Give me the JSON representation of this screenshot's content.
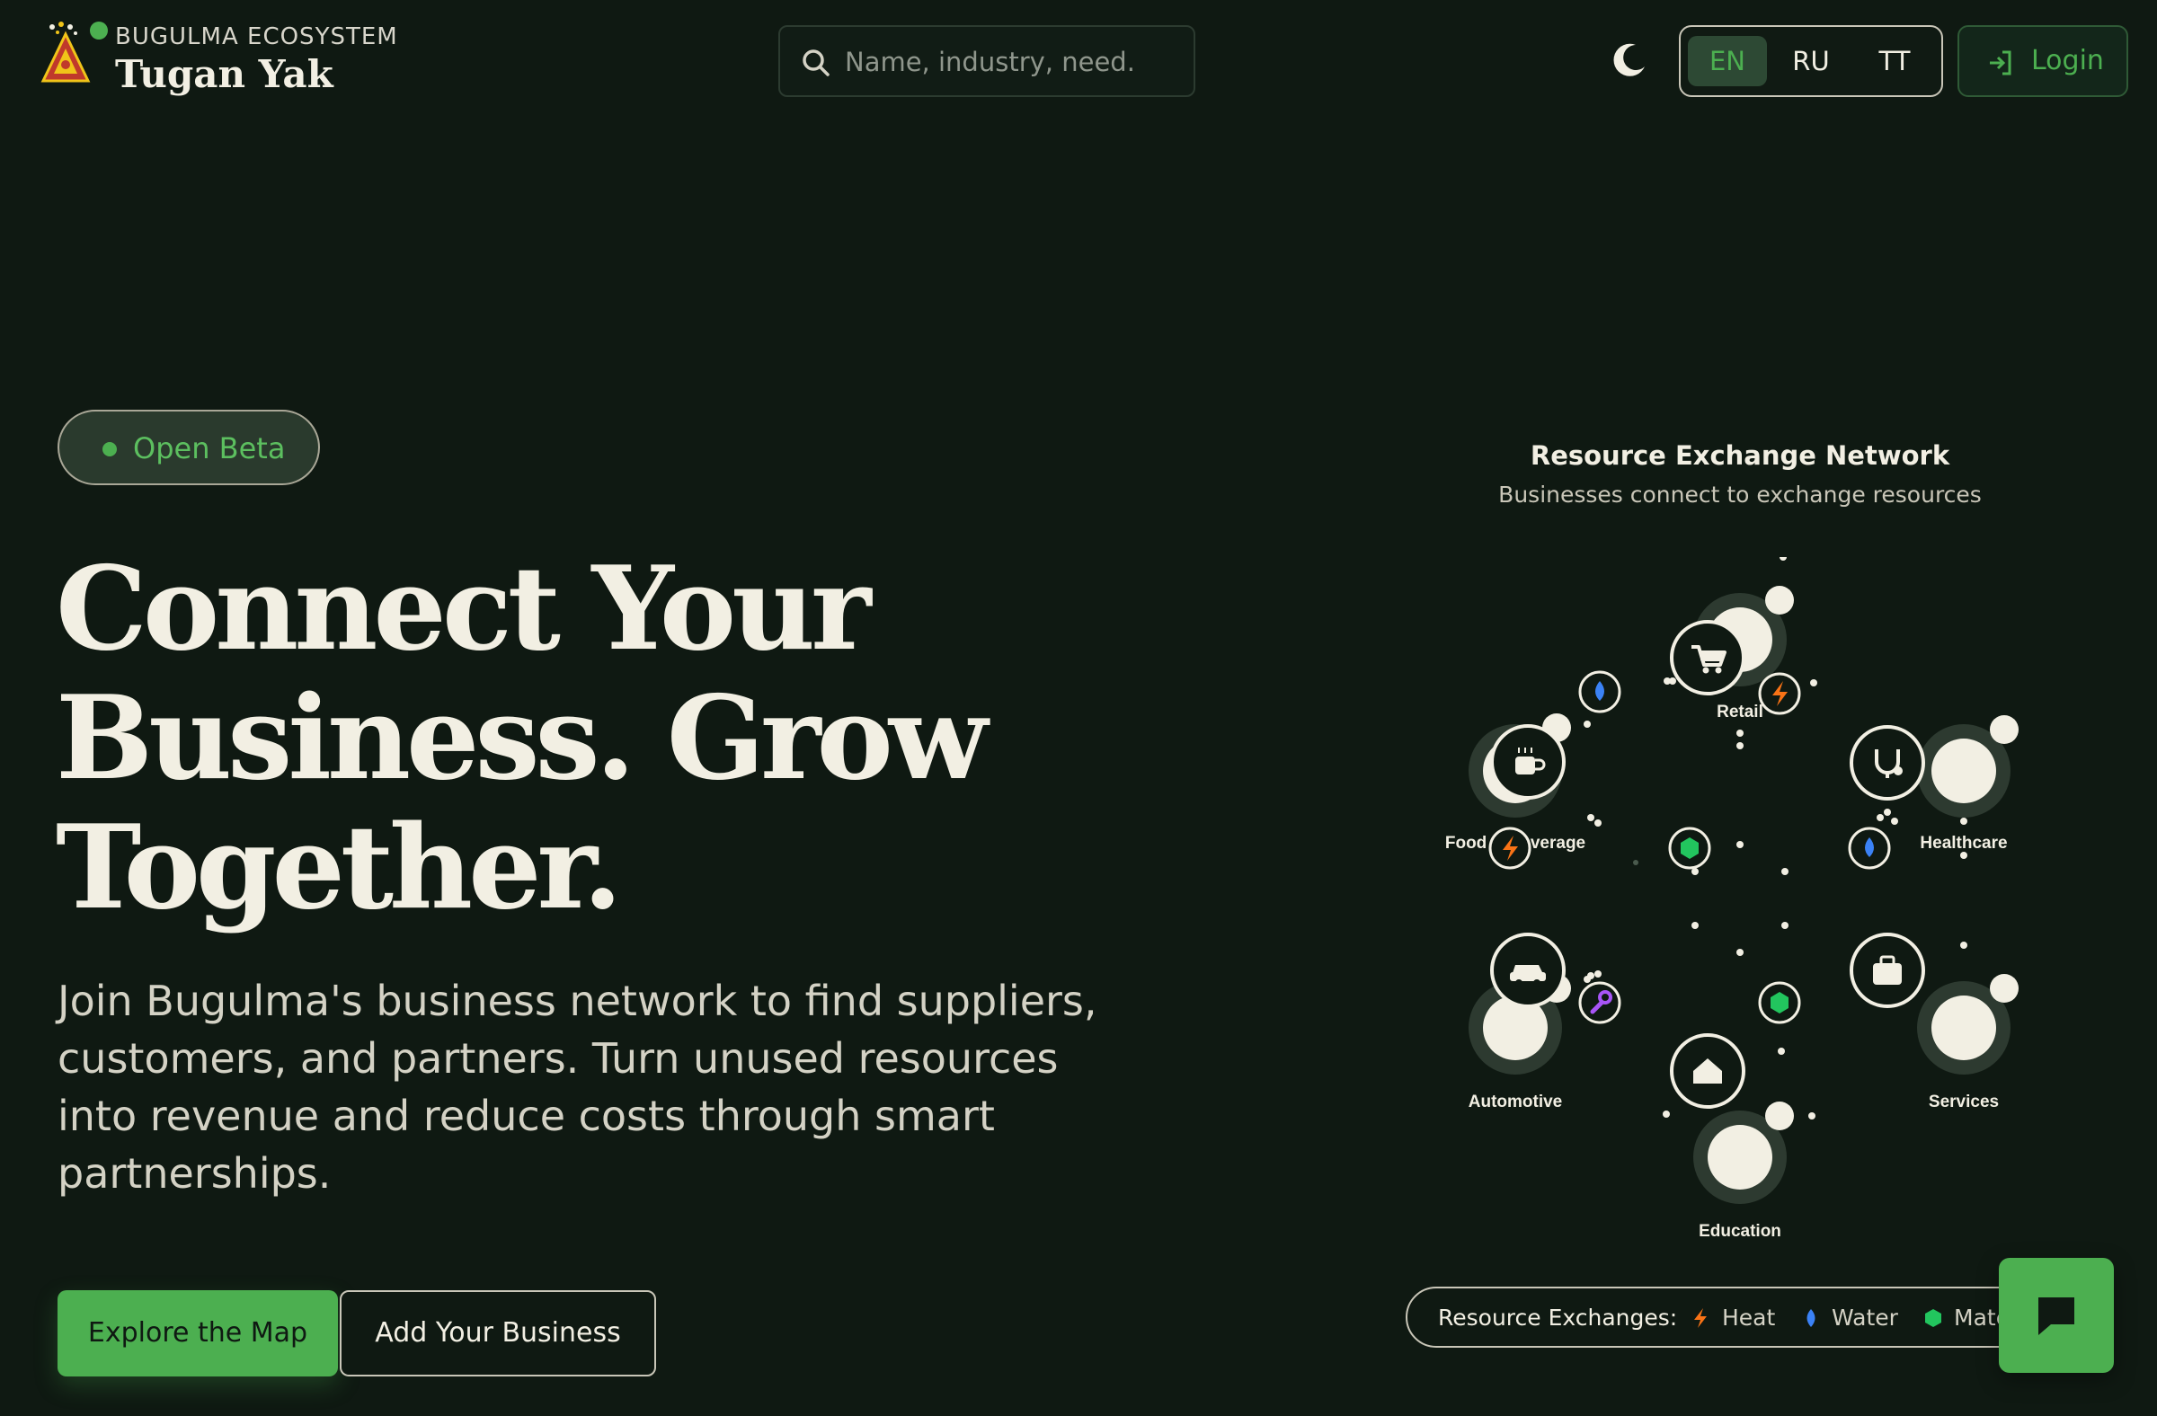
{
  "header": {
    "eyebrow": "BUGULMA ECOSYSTEM",
    "brand_name": "Tugan Yak",
    "logo_icon": "pyramid-emblem-logo",
    "search_placeholder": "Name, industry, need.",
    "theme_icon": "moon-icon",
    "languages": [
      {
        "code": "EN",
        "active": true
      },
      {
        "code": "RU",
        "active": false
      },
      {
        "code": "TT",
        "active": false
      }
    ],
    "login_label": "Login"
  },
  "hero": {
    "badge": "Open Beta",
    "headline_line1": "Connect Your",
    "headline_line2": "Business. Grow",
    "headline_line3": "Together.",
    "subtext": "Join Bugulma's business network to find suppliers, customers, and partners. Turn unused resources into revenue and reduce costs through smart partnerships.",
    "primary_cta": "Explore the Map",
    "secondary_cta": "Add Your Business"
  },
  "network": {
    "title": "Resource Exchange Network",
    "subtitle": "Businesses connect to exchange resources",
    "nodes": [
      {
        "label": "Retail",
        "icon": "cart-icon"
      },
      {
        "label": "Healthcare",
        "icon": "stethoscope-icon"
      },
      {
        "label": "Services",
        "icon": "briefcase-icon"
      },
      {
        "label": "Education",
        "icon": "school-icon"
      },
      {
        "label": "Automotive",
        "icon": "car-icon"
      },
      {
        "label": "Food & Beverage",
        "icon": "coffee-icon"
      }
    ],
    "resource_markers": [
      {
        "type": "heat",
        "icon": "lightning-icon"
      },
      {
        "type": "water",
        "icon": "droplet-icon"
      },
      {
        "type": "materials",
        "icon": "hexagon-icon"
      },
      {
        "type": "services",
        "icon": "wrench-icon"
      }
    ]
  },
  "legend": {
    "title": "Resource Exchanges:",
    "items": [
      {
        "label": "Heat",
        "icon": "lightning-icon",
        "color": "#f97316"
      },
      {
        "label": "Water",
        "icon": "droplet-icon",
        "color": "#3b82f6"
      },
      {
        "label": "Materials",
        "icon": "hexagon-icon",
        "color": "#22c55e"
      }
    ]
  },
  "chat": {
    "icon": "chat-bubble-icon"
  },
  "colors": {
    "background": "#0f1912",
    "accent": "#4caf50",
    "text": "#f2efe3",
    "heat": "#f97316",
    "water": "#3b82f6",
    "materials": "#22c55e",
    "tools": "#a855f7"
  }
}
